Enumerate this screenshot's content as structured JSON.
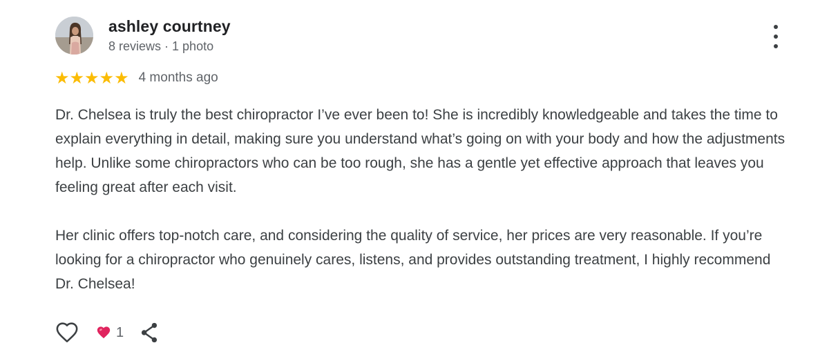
{
  "review": {
    "author": "ashley courtney",
    "reviews_count": "8 reviews",
    "separator": " · ",
    "photos_count": "1 photo",
    "rating": 5,
    "stars": [
      "★",
      "★",
      "★",
      "★",
      "★"
    ],
    "date": "4 months ago",
    "paragraphs": [
      "Dr. Chelsea is truly the best chiropractor I’ve ever been to! She is incredibly knowledgeable and takes the time to explain everything in detail, making sure you understand what’s going on with your body and how the adjustments help. Unlike some chiropractors who can be too rough, she has a gentle yet effective approach that leaves you feeling great after each visit.",
      "Her clinic offers top-notch care, and considering the quality of service, her prices are very reasonable. If you’re looking for a chiropractor who genuinely cares, listens, and provides outstanding treatment, I highly recommend Dr. Chelsea!"
    ]
  },
  "actions": {
    "like_icon": "heart-outline-icon",
    "reaction_icon": "red-heart-icon",
    "reaction_count": "1",
    "share_icon": "share-icon"
  },
  "colors": {
    "star": "#fbbc04",
    "reaction_heart": "#e0245e"
  }
}
